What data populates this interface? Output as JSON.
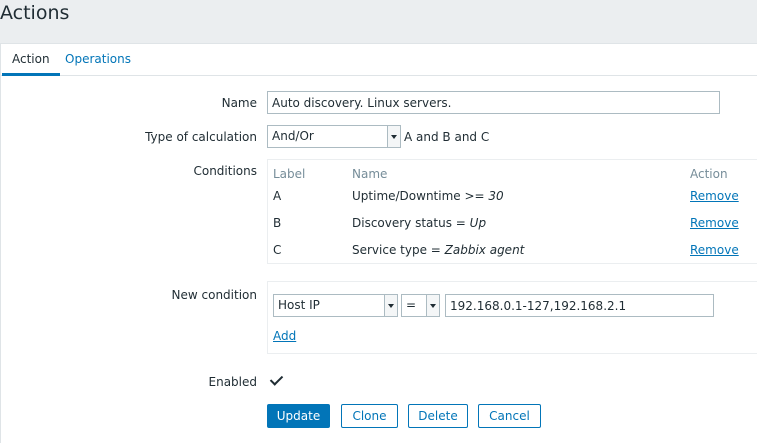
{
  "header": {
    "title": "Actions"
  },
  "tabs": [
    {
      "label": "Action",
      "active": true
    },
    {
      "label": "Operations",
      "active": false
    }
  ],
  "form": {
    "name_label": "Name",
    "name_value": "Auto discovery. Linux servers.",
    "calc_label": "Type of calculation",
    "calc_value": "And/Or",
    "calc_expression": "A and B and C",
    "conditions_label": "Conditions",
    "conditions_columns": {
      "label": "Label",
      "name": "Name",
      "action": "Action"
    },
    "conditions": [
      {
        "label": "A",
        "name_prefix": "Uptime/Downtime >= ",
        "name_value": "30",
        "action": "Remove"
      },
      {
        "label": "B",
        "name_prefix": "Discovery status = ",
        "name_value": "Up",
        "action": "Remove"
      },
      {
        "label": "C",
        "name_prefix": "Service type = ",
        "name_value": "Zabbix agent",
        "action": "Remove"
      }
    ],
    "new_condition_label": "New condition",
    "new_condition_type": "Host IP",
    "new_condition_operator": "=",
    "new_condition_value": "192.168.0.1-127,192.168.2.1",
    "add_label": "Add",
    "enabled_label": "Enabled",
    "enabled": true
  },
  "buttons": {
    "update": "Update",
    "clone": "Clone",
    "delete": "Delete",
    "cancel": "Cancel"
  },
  "colors": {
    "accent": "#0275b8",
    "background": "#ebeef0",
    "text": "#1f2c33",
    "muted": "#768d99"
  }
}
